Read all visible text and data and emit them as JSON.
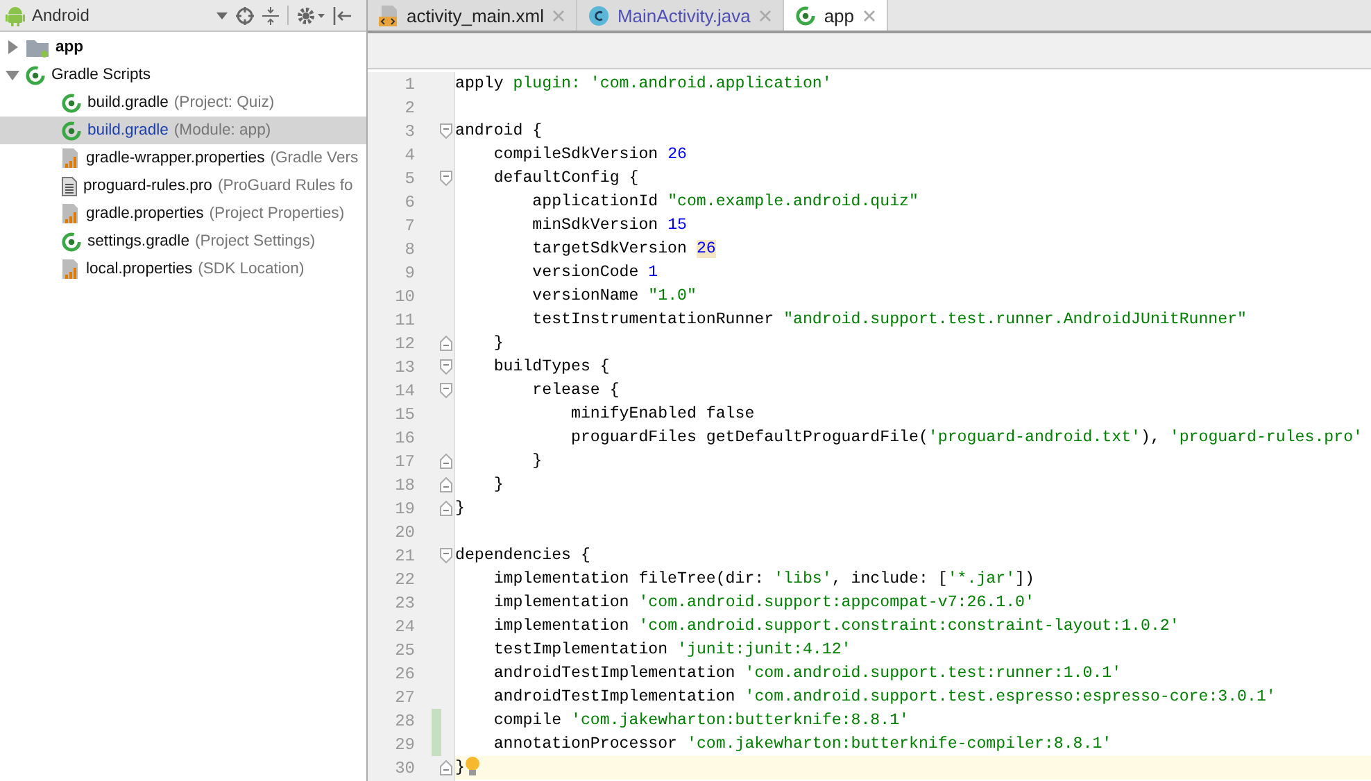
{
  "project_view": {
    "title": "Android"
  },
  "tree": [
    {
      "label": "app",
      "kind": "module",
      "expanded": false,
      "selected": false
    },
    {
      "label": "Gradle Scripts",
      "kind": "gradle",
      "expanded": true,
      "selected": false,
      "children": [
        {
          "label": "build.gradle",
          "detail": "(Project: Quiz)",
          "kind": "gradle",
          "selected": false
        },
        {
          "label": "build.gradle",
          "detail": "(Module: app)",
          "kind": "gradle",
          "selected": true
        },
        {
          "label": "gradle-wrapper.properties",
          "detail": "(Gradle Vers",
          "kind": "properties",
          "selected": false
        },
        {
          "label": "proguard-rules.pro",
          "detail": "(ProGuard Rules fo",
          "kind": "text",
          "selected": false
        },
        {
          "label": "gradle.properties",
          "detail": "(Project Properties)",
          "kind": "properties",
          "selected": false
        },
        {
          "label": "settings.gradle",
          "detail": "(Project Settings)",
          "kind": "gradle",
          "selected": false
        },
        {
          "label": "local.properties",
          "detail": "(SDK Location)",
          "kind": "properties",
          "selected": false
        }
      ]
    }
  ],
  "tabs": [
    {
      "label": "activity_main.xml",
      "kind": "xml",
      "selected": false
    },
    {
      "label": "MainActivity.java",
      "kind": "java",
      "selected": false
    },
    {
      "label": "app",
      "kind": "gradle",
      "selected": true
    }
  ],
  "editor": {
    "lines": [
      {
        "number": "1",
        "kind": "plain",
        "segments": [
          {
            "text": "apply ",
            "kind": "plain"
          },
          {
            "text": "plugin:",
            "kind": "named"
          },
          {
            "text": "'com.android.application'",
            "kind": "string"
          }
        ]
      },
      {
        "number": "2",
        "kind": "plain"
      },
      {
        "number": "3",
        "kind": "fold_start",
        "segments": [
          {
            "text": "android {",
            "kind": "plain"
          }
        ]
      },
      {
        "number": "4",
        "kind": "plain",
        "segments": [
          {
            "text": "    compileSdkVersion ",
            "kind": "plain"
          },
          {
            "text": "26",
            "kind": "number"
          }
        ]
      },
      {
        "number": "5",
        "kind": "fold_start",
        "segments": [
          {
            "text": "    defaultConfig {",
            "kind": "plain"
          }
        ]
      },
      {
        "number": "6",
        "kind": "plain",
        "segments": [
          {
            "text": "        applicationId ",
            "kind": "plain"
          },
          {
            "text": "\"com.example.android.quiz\"",
            "kind": "string"
          }
        ]
      },
      {
        "number": "7",
        "kind": "plain",
        "segments": [
          {
            "text": "        minSdkVersion ",
            "kind": "plain"
          },
          {
            "text": "15",
            "kind": "number"
          }
        ]
      },
      {
        "number": "8",
        "kind": "plain",
        "segments": [
          {
            "text": "        targetSdkVersion ",
            "kind": "plain"
          },
          {
            "text": "26",
            "kind": "highlight"
          }
        ]
      },
      {
        "number": "9",
        "kind": "plain",
        "segments": [
          {
            "text": "        versionCode ",
            "kind": "plain"
          },
          {
            "text": "1",
            "kind": "number"
          }
        ]
      },
      {
        "number": "10",
        "kind": "plain",
        "segments": [
          {
            "text": "        versionName ",
            "kind": "plain"
          },
          {
            "text": "\"1.0\"",
            "kind": "string"
          }
        ]
      },
      {
        "number": "11",
        "kind": "plain",
        "segments": [
          {
            "text": "        testInstrumentationRunner ",
            "kind": "plain"
          },
          {
            "text": "\"android.support.test.runner.AndroidJUnitRunner\"",
            "kind": "string"
          }
        ]
      },
      {
        "number": "12",
        "kind": "fold_end",
        "segments": [
          {
            "text": "    }",
            "kind": "plain"
          }
        ]
      },
      {
        "number": "13",
        "kind": "fold_start",
        "segments": [
          {
            "text": "    buildTypes {",
            "kind": "plain"
          }
        ]
      },
      {
        "number": "14",
        "kind": "fold_start",
        "segments": [
          {
            "text": "        release {",
            "kind": "plain"
          }
        ]
      },
      {
        "number": "15",
        "kind": "plain",
        "segments": [
          {
            "text": "            minifyEnabled false",
            "kind": "plain"
          }
        ]
      },
      {
        "number": "16",
        "kind": "plain",
        "segments": [
          {
            "text": "            proguardFiles getDefaultProguardFile(",
            "kind": "plain"
          },
          {
            "text": "'proguard-android.txt'",
            "kind": "string"
          },
          {
            "text": "), ",
            "kind": "plain"
          },
          {
            "text": "'proguard-rules.pro'",
            "kind": "string"
          }
        ]
      },
      {
        "number": "17",
        "kind": "fold_end",
        "segments": [
          {
            "text": "        }",
            "kind": "plain"
          }
        ]
      },
      {
        "number": "18",
        "kind": "fold_end",
        "segments": [
          {
            "text": "    }",
            "kind": "plain"
          }
        ]
      },
      {
        "number": "19",
        "kind": "fold_end",
        "segments": [
          {
            "text": "}",
            "kind": "plain"
          }
        ]
      },
      {
        "number": "20",
        "kind": "plain"
      },
      {
        "number": "21",
        "kind": "fold_start",
        "segments": [
          {
            "text": "dependencies {",
            "kind": "plain"
          }
        ]
      },
      {
        "number": "22",
        "kind": "plain",
        "segments": [
          {
            "text": "    implementation fileTree(dir: ",
            "kind": "plain"
          },
          {
            "text": "'libs'",
            "kind": "string"
          },
          {
            "text": ", include: [",
            "kind": "plain"
          },
          {
            "text": "'*.jar'",
            "kind": "string"
          },
          {
            "text": "])",
            "kind": "plain"
          }
        ]
      },
      {
        "number": "23",
        "kind": "plain",
        "segments": [
          {
            "text": "    implementation ",
            "kind": "plain"
          },
          {
            "text": "'com.android.support:appcompat-v7:26.1.0'",
            "kind": "string"
          }
        ]
      },
      {
        "number": "24",
        "kind": "plain",
        "segments": [
          {
            "text": "    implementation ",
            "kind": "plain"
          },
          {
            "text": "'com.android.support.constraint:constraint-layout:1.0.2'",
            "kind": "string"
          }
        ]
      },
      {
        "number": "25",
        "kind": "plain",
        "segments": [
          {
            "text": "    testImplementation ",
            "kind": "plain"
          },
          {
            "text": "'junit:junit:4.12'",
            "kind": "string"
          }
        ]
      },
      {
        "number": "26",
        "kind": "plain",
        "segments": [
          {
            "text": "    androidTestImplementation ",
            "kind": "plain"
          },
          {
            "text": "'com.android.support.test:runner:1.0.1'",
            "kind": "string"
          }
        ]
      },
      {
        "number": "27",
        "kind": "plain",
        "segments": [
          {
            "text": "    androidTestImplementation ",
            "kind": "plain"
          },
          {
            "text": "'com.android.support.test.espresso:espresso-core:3.0.1'",
            "kind": "string"
          }
        ]
      },
      {
        "number": "28",
        "kind": "plain",
        "modified": true,
        "segments": [
          {
            "text": "    compile ",
            "kind": "plain"
          },
          {
            "text": "'com.jakewharton:butterknife:8.8.1'",
            "kind": "string"
          }
        ]
      },
      {
        "number": "29",
        "kind": "plain",
        "modified": true,
        "segments": [
          {
            "text": "    annotationProcessor ",
            "kind": "plain"
          },
          {
            "text": "'com.jakewharton:butterknife-compiler:8.8.1'",
            "kind": "string"
          }
        ]
      },
      {
        "number": "30",
        "kind": "fold_end",
        "bulb": true,
        "current": true,
        "segments": [
          {
            "text": "}",
            "kind": "plain"
          }
        ]
      }
    ]
  }
}
